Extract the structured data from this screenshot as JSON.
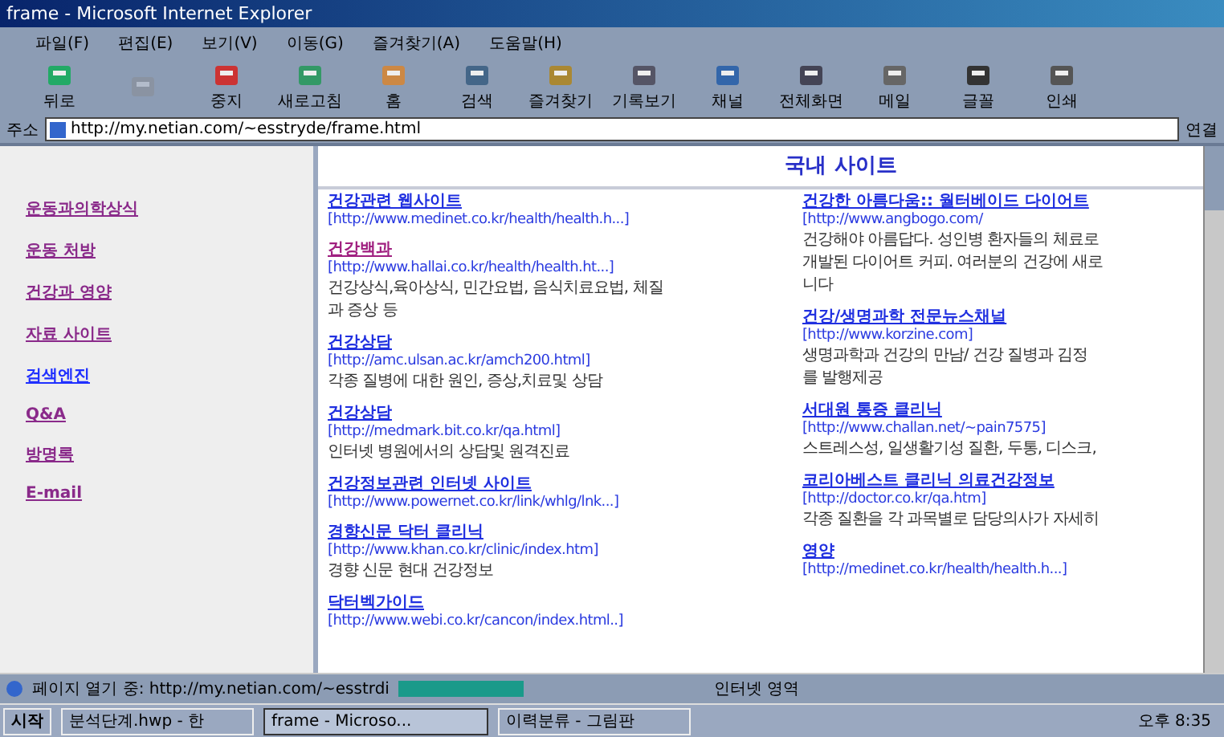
{
  "window": {
    "title": "frame - Microsoft Internet Explorer"
  },
  "menu": [
    "파일(F)",
    "편집(E)",
    "보기(V)",
    "이동(G)",
    "즐겨찾기(A)",
    "도움말(H)"
  ],
  "toolbar": [
    {
      "label": "뒤로",
      "kind": "back",
      "disabled": false
    },
    {
      "kind": "forward",
      "disabled": true
    },
    {
      "label": "중지",
      "kind": "stop",
      "disabled": false
    },
    {
      "label": "새로고침",
      "kind": "refresh",
      "disabled": false
    },
    {
      "label": "홈",
      "kind": "home",
      "disabled": false
    },
    {
      "label": "검색",
      "kind": "search",
      "disabled": false
    },
    {
      "label": "즐겨찾기",
      "kind": "favorites",
      "disabled": false
    },
    {
      "label": "기록보기",
      "kind": "history",
      "disabled": false
    },
    {
      "label": "채널",
      "kind": "channel",
      "disabled": false
    },
    {
      "label": "전체화면",
      "kind": "fullscreen",
      "disabled": false
    },
    {
      "label": "메일",
      "kind": "mail",
      "disabled": false
    },
    {
      "label": "글꼴",
      "kind": "font",
      "disabled": false
    },
    {
      "label": "인쇄",
      "kind": "print",
      "disabled": false
    }
  ],
  "address": {
    "label": "주소",
    "value": "http://my.netian.com/~esstryde/frame.html",
    "go": "연결"
  },
  "nav": [
    {
      "label": "운동과의학상식",
      "visited": true
    },
    {
      "label": "운동 처방",
      "visited": true
    },
    {
      "label": "건강과 영양",
      "visited": true
    },
    {
      "label": "자료 사이트",
      "visited": true
    },
    {
      "label": "검색엔진",
      "visited": false
    },
    {
      "label": "Q&A",
      "visited": true
    },
    {
      "label": "방명록",
      "visited": true
    },
    {
      "label": "E-mail",
      "visited": true
    }
  ],
  "heading": "국내 사이트",
  "columns": [
    [
      {
        "title": "건강관련 웹사이트",
        "visited": false,
        "url": "[http://www.medinet.co.kr/health/health.h...]"
      },
      {
        "title": "건강백과",
        "visited": true,
        "url": "[http://www.hallai.co.kr/health/health.ht...]",
        "description": [
          "건강상식,육아상식, 민간요법, 음식치료요법, 체질",
          "과 증상 등"
        ]
      },
      {
        "title": "건강상담",
        "visited": false,
        "url": "[http://amc.ulsan.ac.kr/amch200.html]",
        "description": [
          "각종 질병에 대한 원인, 증상,치료및 상담"
        ]
      },
      {
        "title": "건강상담",
        "visited": false,
        "url": "[http://medmark.bit.co.kr/qa.html]",
        "description": [
          "인터넷 병원에서의 상담및 원격진료"
        ]
      },
      {
        "title": "건강정보관련 인터넷 사이트",
        "visited": false,
        "url": "[http://www.powernet.co.kr/link/whlg/lnk...]"
      },
      {
        "title": "경향신문 닥터 클리닉",
        "visited": false,
        "url": "[http://www.khan.co.kr/clinic/index.htm]",
        "description": [
          "경향 신문 현대 건강정보"
        ]
      },
      {
        "title": "닥터벡가이드",
        "visited": false,
        "url": "[http://www.webi.co.kr/cancon/index.html..]"
      }
    ],
    [
      {
        "title": "건강한 아름다움:: 월터베이드 다이어트",
        "visited": false,
        "url": "[http://www.angbogo.com/",
        "description": [
          "건강해야 아름답다. 성인병 환자들의 체료로",
          "개발된 다이어트 커피. 여러분의 건강에 새로",
          "니다"
        ]
      },
      {
        "title": "건강/생명과학 전문뉴스채널",
        "visited": false,
        "url": "[http://www.korzine.com]",
        "description": [
          "생명과학과 건강의 만남/ 건강 질병과 김정",
          "를 발행제공"
        ]
      },
      {
        "title": "서대원 통증 클리닉",
        "visited": false,
        "url": "[http://www.challan.net/~pain7575]",
        "description": [
          "스트레스성, 일생활기성 질환, 두통, 디스크,"
        ]
      },
      {
        "title": "코리아베스트 클리닉 의료건강정보",
        "visited": false,
        "url": "[http://doctor.co.kr/qa.htm]",
        "description": [
          "각종 질환을 각 과목별로 담당의사가 자세히"
        ]
      },
      {
        "title": "영양",
        "visited": false,
        "url": "[http://medinet.co.kr/health/health.h...]"
      }
    ]
  ],
  "status": {
    "text": "페이지 열기 중: http://my.netian.com/~esstrdi",
    "level": 0.6,
    "zone": "인터넷 영역"
  },
  "taskbar": {
    "start": "시작",
    "tasks": [
      {
        "label": "분석단계.hwp - 한",
        "selected": false
      },
      {
        "label": "frame - Microso...",
        "selected": true
      },
      {
        "label": "이력분류 - 그림판",
        "selected": false
      }
    ],
    "clock": "오후 8:35"
  }
}
